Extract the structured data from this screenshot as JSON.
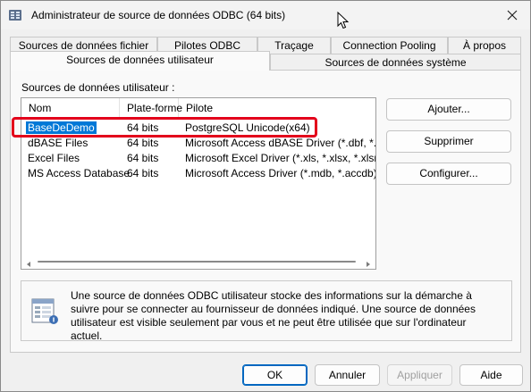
{
  "window": {
    "title": "Administrateur de source de données ODBC (64 bits)"
  },
  "tabs": {
    "row_back": [
      {
        "label": "Sources de données fichier"
      },
      {
        "label": "Pilotes ODBC"
      },
      {
        "label": "Traçage"
      },
      {
        "label": "Connection Pooling"
      },
      {
        "label": "À propos"
      }
    ],
    "row_front": [
      {
        "label": "Sources de données utilisateur",
        "selected": true
      },
      {
        "label": "Sources de données système",
        "selected": false
      }
    ]
  },
  "panel": {
    "list_label": "Sources de données utilisateur :",
    "columns": [
      "Nom",
      "Plate-forme",
      "Pilote"
    ],
    "rows": [
      {
        "name": "BaseDeDemo",
        "platform": "64 bits",
        "driver": "PostgreSQL Unicode(x64)",
        "selected": true
      },
      {
        "name": "dBASE Files",
        "platform": "64 bits",
        "driver": "Microsoft Access dBASE Driver (*.dbf, *.ndx,"
      },
      {
        "name": "Excel Files",
        "platform": "64 bits",
        "driver": "Microsoft Excel Driver (*.xls, *.xlsx, *.xlsm, *.xls"
      },
      {
        "name": "MS Access Database",
        "platform": "64 bits",
        "driver": "Microsoft Access Driver (*.mdb, *.accdb)"
      }
    ],
    "buttons": {
      "add": "Ajouter...",
      "remove": "Supprimer",
      "configure": "Configurer..."
    },
    "info_text": "Une source de données ODBC utilisateur stocke des informations sur la démarche à suivre pour se connecter au fournisseur de données indiqué.   Une source de données utilisateur est visible seulement par vous et ne peut être utilisée que sur l'ordinateur actuel."
  },
  "footer": {
    "ok": "OK",
    "cancel": "Annuler",
    "apply": "Appliquer",
    "help": "Aide"
  },
  "colors": {
    "selection": "#0078d7",
    "highlight_annotation": "#e3001b",
    "primary_border": "#0067c0"
  },
  "icons": [
    "odbc-app-icon",
    "close-icon",
    "mouse-cursor-icon",
    "scroll-left-icon",
    "scroll-right-icon",
    "data-source-info-icon"
  ]
}
